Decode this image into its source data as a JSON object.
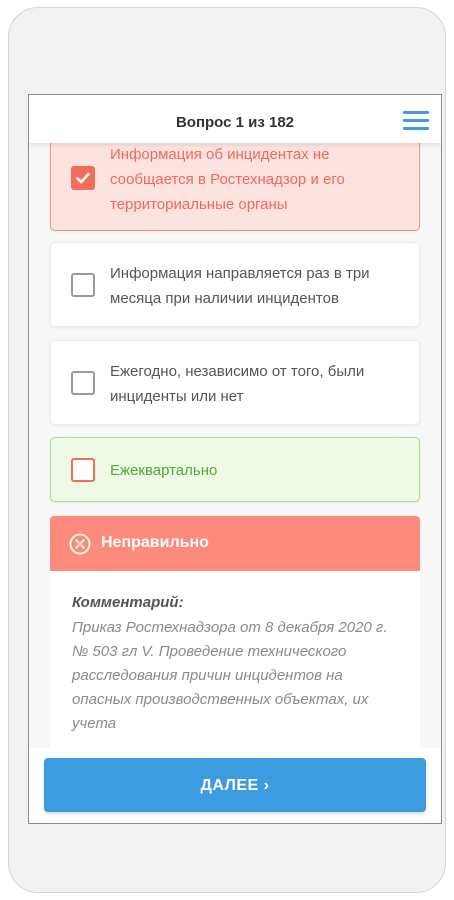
{
  "header": {
    "title": "Вопрос 1 из 182"
  },
  "options": [
    {
      "text": "Информация об инцидентах не сообщается в Ростехнадзор и его территориальные органы",
      "state": "wrong-selected"
    },
    {
      "text": "Информация направляется раз в три месяца при наличии инцидентов",
      "state": "neutral"
    },
    {
      "text": "Ежегодно, независимо от того, были инциденты или нет",
      "state": "neutral"
    },
    {
      "text": "Ежеквартально",
      "state": "correct"
    }
  ],
  "result": {
    "title": "Неправильно",
    "comment_label": "Комментарий:",
    "comment_text": "Приказ Ростехнадзора от 8 декабря 2020 г. № 503 гл V. Проведение технического расследования причин инцидентов на опасных производственных объектах, их учета"
  },
  "footer": {
    "next_label": "ДАЛЕЕ ›"
  },
  "colors": {
    "accent": "#3d9be0",
    "wrong": "#f26d5b",
    "wrong_header": "#fd8b7b",
    "correct": "#55a832"
  }
}
